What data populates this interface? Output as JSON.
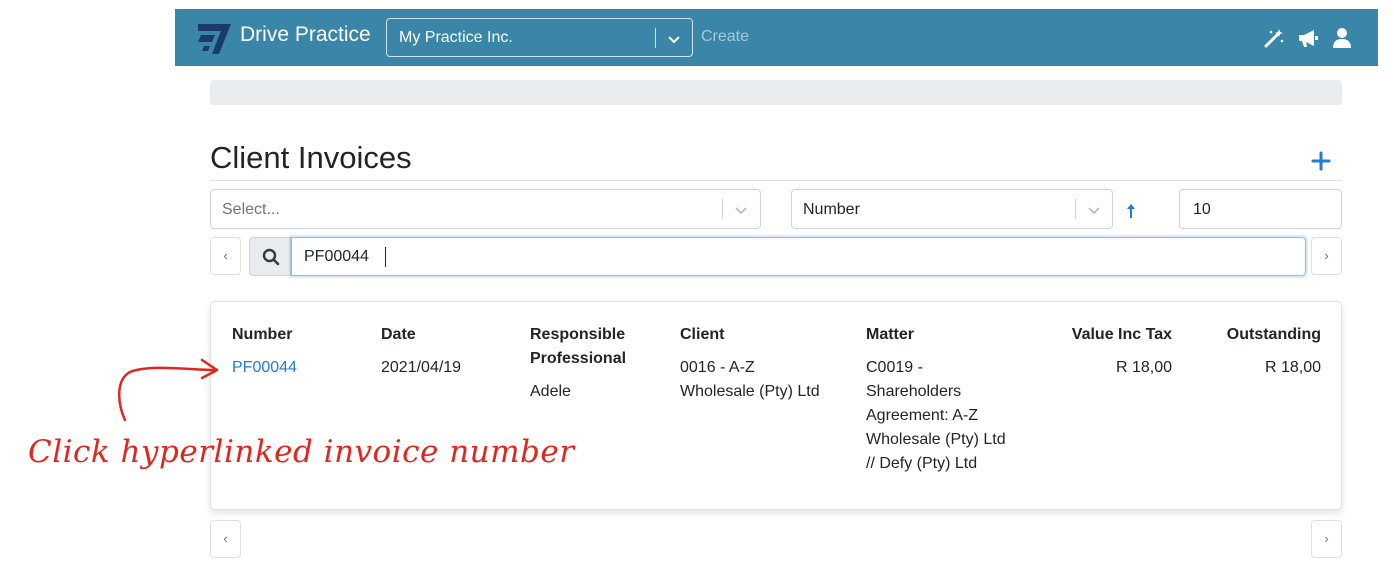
{
  "app": {
    "name": "Drive Practice",
    "practice_selected": "My Practice Inc.",
    "create_label": "Create",
    "nav_icons": [
      "magic-wand-icon",
      "megaphone-icon",
      "user-icon"
    ],
    "brand_color": "#3a86a8"
  },
  "page": {
    "title": "Client Invoices"
  },
  "filters": {
    "select_placeholder": "Select...",
    "sort_by": "Number",
    "sort_direction": "ascending",
    "page_size": "10",
    "search_value": "PF00044"
  },
  "pager": {
    "prev": "‹",
    "next": "›"
  },
  "table": {
    "headers": {
      "number": "Number",
      "date": "Date",
      "responsible_1": "Responsible",
      "responsible_2": "Professional",
      "client": "Client",
      "matter": "Matter",
      "value": "Value Inc Tax",
      "outstanding": "Outstanding"
    },
    "rows": [
      {
        "number": "PF00044",
        "date": "2021/04/19",
        "responsible": "Adele",
        "client_lines": [
          "0016 - A-Z",
          "Wholesale (Pty) Ltd"
        ],
        "matter_lines": [
          "C0019 -",
          "Shareholders",
          "Agreement: A-Z",
          "Wholesale (Pty) Ltd",
          "// Defy (Pty) Ltd"
        ],
        "value": "R 18,00",
        "outstanding": "R 18,00"
      }
    ]
  },
  "annotation": {
    "text": "Click hyperlinked invoice number",
    "color": "#e0261f"
  },
  "colors": {
    "link": "#1e7dd6",
    "accent": "#1e7dd6"
  }
}
